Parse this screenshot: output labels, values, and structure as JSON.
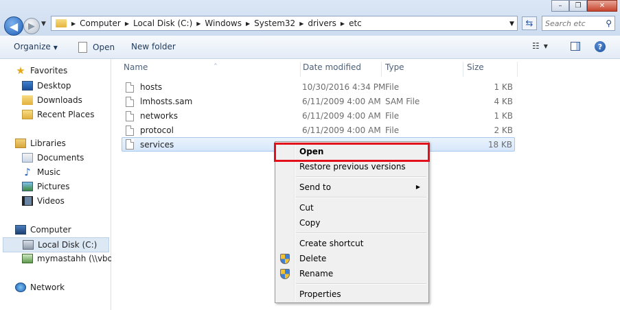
{
  "window": {
    "min_label": "–",
    "max_label": "❐",
    "close_label": "✕"
  },
  "nav": {
    "back_glyph": "◀",
    "forward_glyph": "▶",
    "dropdown_glyph": "▼"
  },
  "address": {
    "separator_glyph": "▶",
    "segments": [
      "Computer",
      "Local Disk (C:)",
      "Windows",
      "System32",
      "drivers",
      "etc"
    ],
    "dropdown_glyph": "▼",
    "refresh_glyph": "⇆"
  },
  "search": {
    "placeholder": "Search etc",
    "icon_glyph": "⚲"
  },
  "toolbar": {
    "organize_label": "Organize",
    "organize_dd": "▼",
    "open_label": "Open",
    "new_folder_label": "New folder",
    "view_glyph": "☷",
    "view_dd": "▼",
    "help_glyph": "?"
  },
  "sidebar": {
    "favorites": "Favorites",
    "desktop": "Desktop",
    "downloads": "Downloads",
    "recent_places": "Recent Places",
    "libraries": "Libraries",
    "documents": "Documents",
    "music": "Music",
    "pictures": "Pictures",
    "videos": "Videos",
    "computer": "Computer",
    "local_disk": "Local Disk (C:)",
    "network_drive": "mymastahh (\\\\vbox",
    "network": "Network",
    "star_glyph": "★",
    "music_glyph": "♪"
  },
  "columns": {
    "sort_glyph": "^",
    "name": "Name",
    "date_modified": "Date modified",
    "type": "Type",
    "size": "Size"
  },
  "files": [
    {
      "name": "hosts",
      "date": "10/30/2016 4:34 PM",
      "type": "File",
      "size": "1 KB"
    },
    {
      "name": "lmhosts.sam",
      "date": "6/11/2009 4:00 AM",
      "type": "SAM File",
      "size": "4 KB"
    },
    {
      "name": "networks",
      "date": "6/11/2009 4:00 AM",
      "type": "File",
      "size": "1 KB"
    },
    {
      "name": "protocol",
      "date": "6/11/2009 4:00 AM",
      "type": "File",
      "size": "2 KB"
    },
    {
      "name": "services",
      "date": "",
      "type": "",
      "size": "18 KB"
    }
  ],
  "context_menu": {
    "open": "Open",
    "restore": "Restore previous versions",
    "send_to": "Send to",
    "send_to_arrow": "▶",
    "cut": "Cut",
    "copy": "Copy",
    "create_shortcut": "Create shortcut",
    "delete": "Delete",
    "rename": "Rename",
    "properties": "Properties"
  },
  "colors": {
    "highlight_box": "#e3101c",
    "selection_fill": "#d6e7fb",
    "toolbar_text": "#1e395b"
  }
}
